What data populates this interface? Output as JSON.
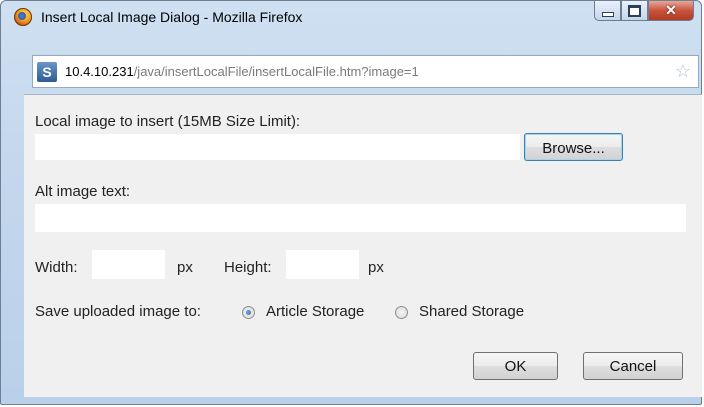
{
  "window": {
    "title": "Insert Local Image Dialog - Mozilla Firefox",
    "app_icon": "firefox-icon",
    "buttons": {
      "minimize": "minimize-icon",
      "maximize": "maximize-icon",
      "close": "close-icon",
      "close_glyph": "✕"
    }
  },
  "urlbar": {
    "site_icon": "site-icon",
    "site_icon_glyph": "S",
    "host": "10.4.10.231",
    "path": "/java/insertLocalFile/insertLocalFile.htm?image=1",
    "bookmark_icon": "star-icon"
  },
  "form": {
    "local_image_label": "Local image to insert (15MB Size Limit):",
    "local_image_value": "",
    "browse_label": "Browse...",
    "alt_text_label": "Alt image text:",
    "alt_text_value": "",
    "width_label": "Width:",
    "width_value": "",
    "width_unit": "px",
    "height_label": "Height:",
    "height_value": "",
    "height_unit": "px",
    "save_to_label": "Save uploaded image to:",
    "storage_options": [
      {
        "label": "Article Storage",
        "selected": true
      },
      {
        "label": "Shared Storage",
        "selected": false
      }
    ],
    "ok_label": "OK",
    "cancel_label": "Cancel"
  },
  "colors": {
    "frame": "#c4d7ed",
    "content_bg": "#f0f0f0",
    "close_button": "#c9543d",
    "focus_border": "#3c7fb1"
  }
}
